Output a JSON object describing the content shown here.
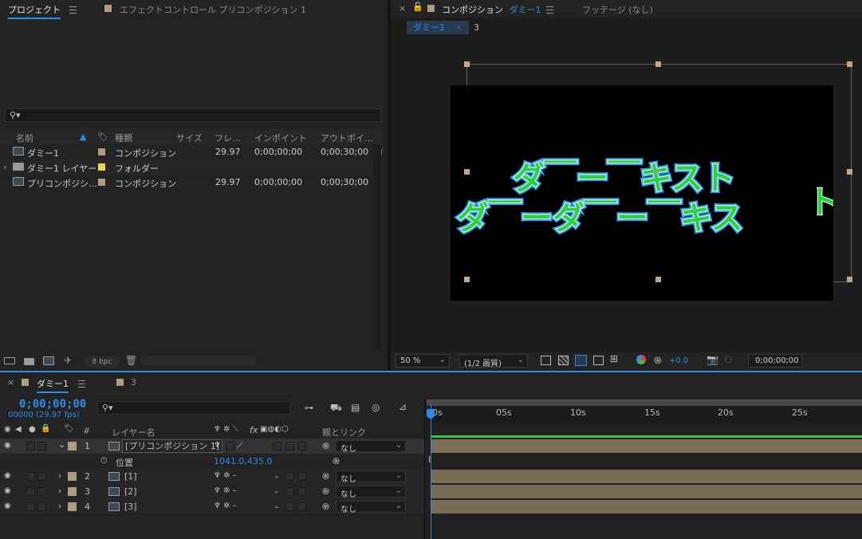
{
  "project_panel": {
    "tab_label": "プロジェクト",
    "effects_tab_label": "エフェクトコントロール プリコンポジション 1",
    "search_placeholder": "",
    "columns": [
      "名前",
      "種類",
      "サイズ",
      "フレ…",
      "インポイント",
      "アウトポイ…"
    ],
    "items": [
      {
        "name": "ダミー1",
        "type": "コンポジション",
        "fps": "29.97",
        "in": "0;00;00;00",
        "out": "0;00;30;00",
        "color": "#b09c82",
        "icon": "composition-icon"
      },
      {
        "name": "ダミー1 レイヤー",
        "type": "フォルダー",
        "fps": "",
        "in": "",
        "out": "",
        "color": "#e8d84a",
        "icon": "folder-icon"
      },
      {
        "name": "プリコンポジシ…",
        "type": "コンポジション",
        "fps": "29.97",
        "in": "0;00;00;00",
        "out": "0;00;30;00",
        "color": "#b09c82",
        "icon": "composition-icon"
      }
    ],
    "bit_depth": "8 bpc"
  },
  "composition_panel": {
    "tab_label": "コンポジション",
    "tab_comp_name": "ダミー1",
    "footage_tab_label": "フッテージ (なし)",
    "breadcrumb_current": "ダミー1",
    "breadcrumb_next": "3",
    "canvas_text_line1": "ダ￣ー￣キスト",
    "canvas_text_line2": "ダ￣ーダ￣ー￣キス",
    "canvas_text_overflow": "ト",
    "zoom": "50 %",
    "resolution": "(1/2 画質)",
    "exposure": "+0.0",
    "timecode": "0;00;00;00"
  },
  "timeline_panel": {
    "tab_label": "ダミー1",
    "second_tab_label": "3",
    "current_time": "0;00;00;00",
    "frame_info": "00000 (29.97 fps)",
    "layer_name_header": "レイヤー名",
    "parent_header": "親とリンク",
    "fx_header": "fx",
    "number_header": "#",
    "ruler_labels": [
      "0s",
      "05s",
      "10s",
      "15s",
      "20s",
      "25s"
    ],
    "layers": [
      {
        "num": "1",
        "name": "[プリコンポジション 1]",
        "parent": "なし",
        "expanded": true
      },
      {
        "num": "2",
        "name": "[1]",
        "parent": "なし",
        "expanded": false
      },
      {
        "num": "3",
        "name": "[2]",
        "parent": "なし",
        "expanded": false
      },
      {
        "num": "4",
        "name": "[3]",
        "parent": "なし",
        "expanded": false
      }
    ],
    "position_property": {
      "label": "位置",
      "value": "1041.0,435.0"
    }
  },
  "colors": {
    "accent_blue": "#2d8ceb",
    "layer_label": "#b09c82",
    "text_fill": "#2bd043",
    "text_stroke": "#29a0e8",
    "work_area_green": "#3fbf3f"
  }
}
